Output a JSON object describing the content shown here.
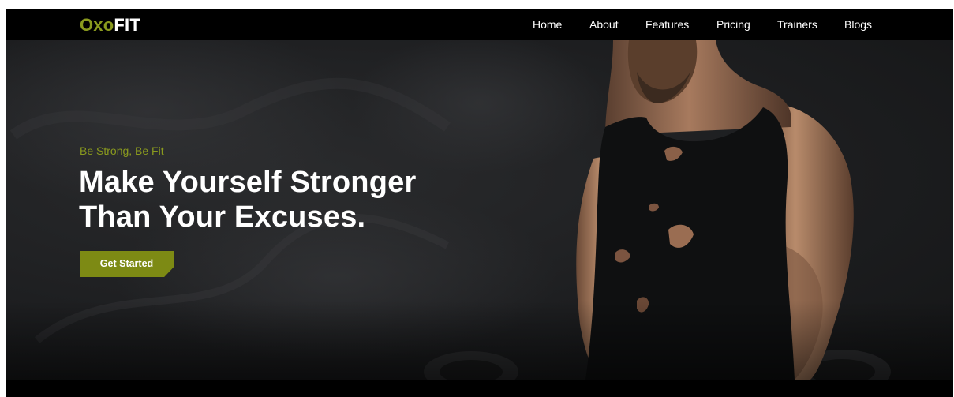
{
  "brand": {
    "prefix": "Oxo",
    "suffix": "FIT"
  },
  "nav": {
    "items": [
      {
        "label": "Home"
      },
      {
        "label": "About"
      },
      {
        "label": "Features"
      },
      {
        "label": "Pricing"
      },
      {
        "label": "Trainers"
      },
      {
        "label": "Blogs"
      }
    ]
  },
  "hero": {
    "tagline": "Be Strong, Be Fit",
    "headline_line1": "Make Yourself Stronger",
    "headline_line2": "Than Your Excuses.",
    "cta_label": "Get Started",
    "image_subject": "bodybuilder-lifting-dumbbells"
  },
  "colors": {
    "accent": "#8a9a1e",
    "cta_background": "#7d8a14",
    "nav_background": "#000000",
    "hero_background": "#1d1e20",
    "text_light": "#ffffff"
  }
}
